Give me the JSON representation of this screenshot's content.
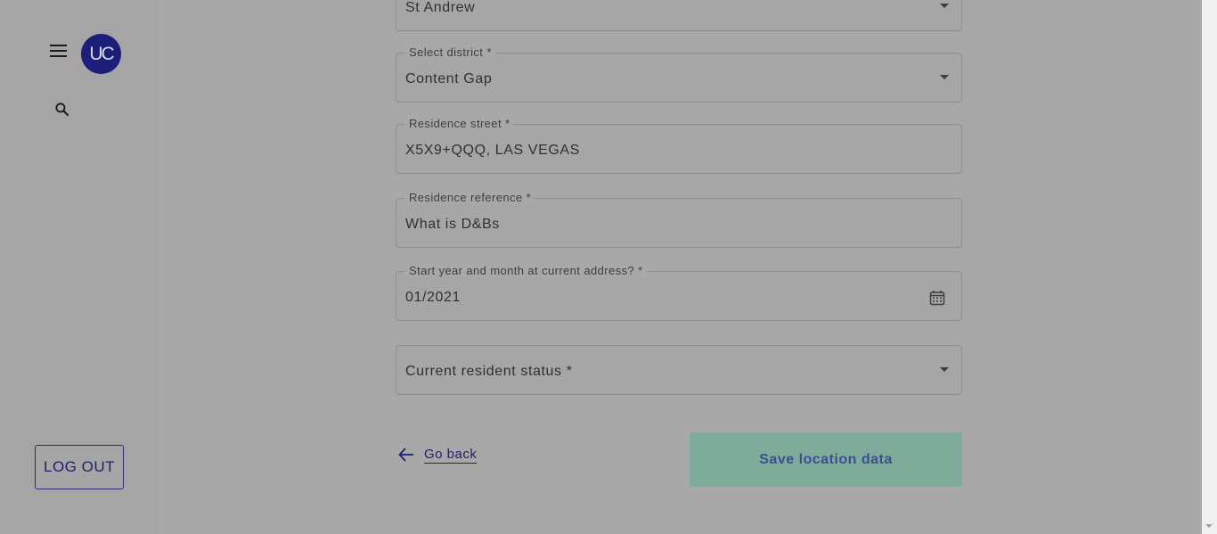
{
  "sidebar": {
    "avatar_text": "UC",
    "logout_label": "LOG OUT"
  },
  "form": {
    "top_field_value": "St Andrew",
    "district": {
      "label": "Select district *",
      "value": "Content Gap"
    },
    "street": {
      "label": "Residence street *",
      "value": "X5X9+QQQ, LAS VEGAS"
    },
    "reference": {
      "label": "Residence reference *",
      "value": "What is D&Bs"
    },
    "start_date": {
      "label": "Start year and month at current address? *",
      "value": "01/2021"
    },
    "resident_status": {
      "placeholder": "Current resident status *"
    }
  },
  "actions": {
    "go_back_label": "Go back",
    "save_label": "Save location data"
  },
  "colors": {
    "brand": "#1c1f7a",
    "save_button": "#7fab9a"
  }
}
